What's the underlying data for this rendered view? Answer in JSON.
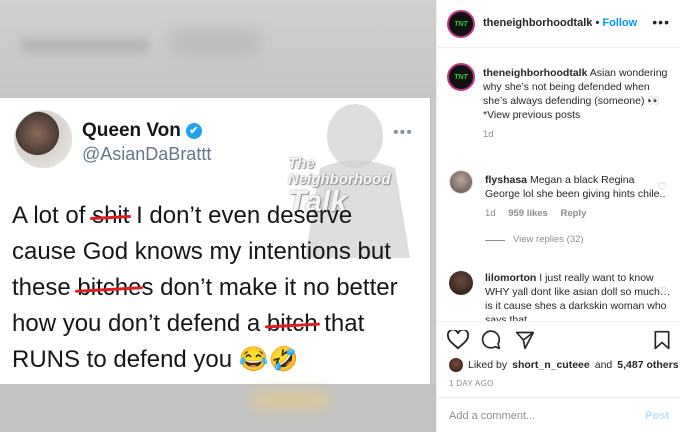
{
  "header": {
    "username": "theneighborhoodtalk",
    "separator": "•",
    "follow_label": "Follow",
    "more_icon": "•••"
  },
  "logo_text": "TNT",
  "tweet": {
    "name": "Queen Von",
    "handle": "@AsianDaBrattt",
    "more": "•••",
    "verified_icon": "✔",
    "segments": [
      {
        "text": "A lot of ",
        "strike": false
      },
      {
        "text": "shit",
        "strike": true
      },
      {
        "text": " I don’t even deserve cause  God knows my intentions but these ",
        "strike": false
      },
      {
        "text": "bitche",
        "strike": true
      },
      {
        "text": "s don’t make it no better how you don’t defend a ",
        "strike": false
      },
      {
        "text": "bitch",
        "strike": true
      },
      {
        "text": " that RUNS to defend you 😂🤣",
        "strike": false
      }
    ]
  },
  "watermark": {
    "line1": "The",
    "line2": "Neighborhood",
    "line3": "Talk"
  },
  "caption": {
    "username": "theneighborhoodtalk",
    "text": " Asian wondering why she’s not being defended when she’s always defending (someone) 👀 *View previous posts",
    "age": "1d"
  },
  "comments": [
    {
      "username": "flyshasa",
      "text": " Megan a black Regina George lol she been giving hints chile..",
      "age": "1d",
      "likes": "959 likes",
      "reply": "Reply",
      "view_replies": "View replies (32)"
    },
    {
      "username": "lilomorton",
      "text": " I just really want to know WHY yall dont like asian doll so much… is it cause shes a darkskin woman who says that"
    }
  ],
  "likes": {
    "prefix": "Liked by",
    "user": "short_n_cuteee",
    "and": "and",
    "count": "5,487 others"
  },
  "time_ago": "1 DAY AGO",
  "comment_input": {
    "placeholder": "Add a comment...",
    "post_label": "Post"
  }
}
